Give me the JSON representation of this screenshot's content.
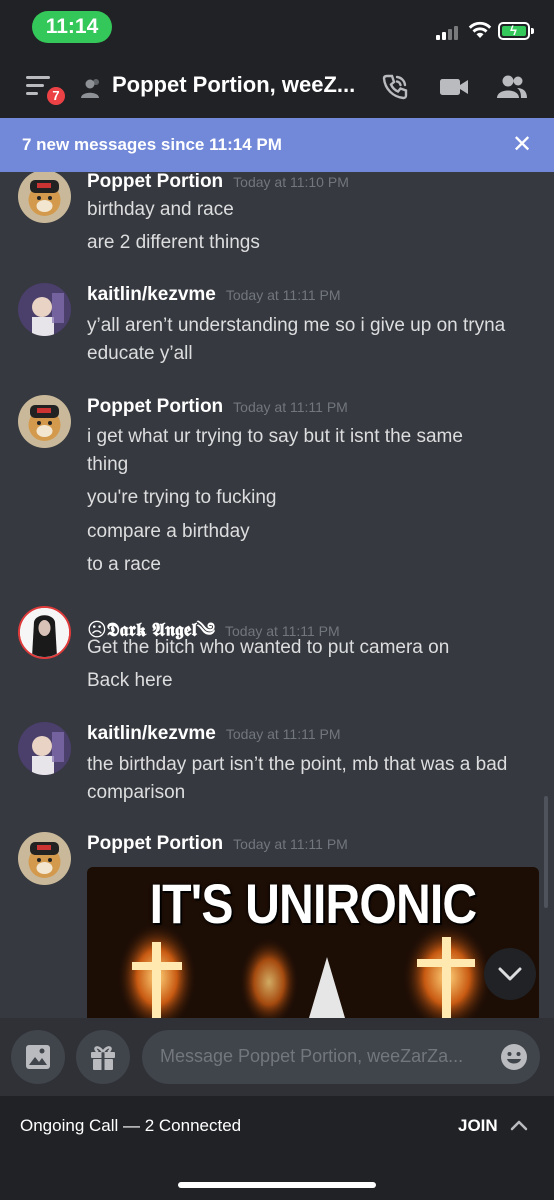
{
  "status_bar": {
    "time": "11:14"
  },
  "header": {
    "badge": "7",
    "title": "Poppet Portion, weeZ..."
  },
  "new_messages": {
    "text": "7 new messages since 11:14 PM",
    "close": "✕"
  },
  "messages": [
    {
      "user": "Poppet Portion",
      "time": "Today at 11:10 PM",
      "lines": [
        "birthday and race",
        "are 2 different things"
      ]
    },
    {
      "user": "kaitlin/kezvme",
      "time": "Today at 11:11 PM",
      "lines": [
        "y’all aren’t understanding me so i give up on tryna",
        "educate y’all"
      ]
    },
    {
      "user": "Poppet Portion",
      "time": "Today at 11:11 PM",
      "lines": [
        "i get what ur trying to say but it isnt the same",
        "thing",
        "you're trying to fucking",
        "compare a birthday",
        "to a race"
      ]
    },
    {
      "user": "☹𝕯𝖆𝖗𝖐 𝕬𝖓𝖌𝖊𝖑༄",
      "time": "Today at 11:11 PM",
      "lines": [
        "Get the bitch who wanted to put camera on",
        "Back here"
      ]
    },
    {
      "user": "kaitlin/kezvme",
      "time": "Today at 11:11 PM",
      "lines": [
        "the birthday part isn’t the point, mb that was a bad",
        "comparison"
      ]
    },
    {
      "user": "Poppet Portion",
      "time": "Today at 11:11 PM",
      "image_caption": "IT'S UNIRONIC"
    }
  ],
  "input": {
    "placeholder": "Message Poppet Portion, weeZarZa..."
  },
  "call": {
    "status": "Ongoing Call — 2 Connected",
    "join": "JOIN"
  },
  "colors": {
    "background": "#36393f",
    "header": "#202225",
    "blurple": "#7289da",
    "badge": "#ed4245"
  }
}
